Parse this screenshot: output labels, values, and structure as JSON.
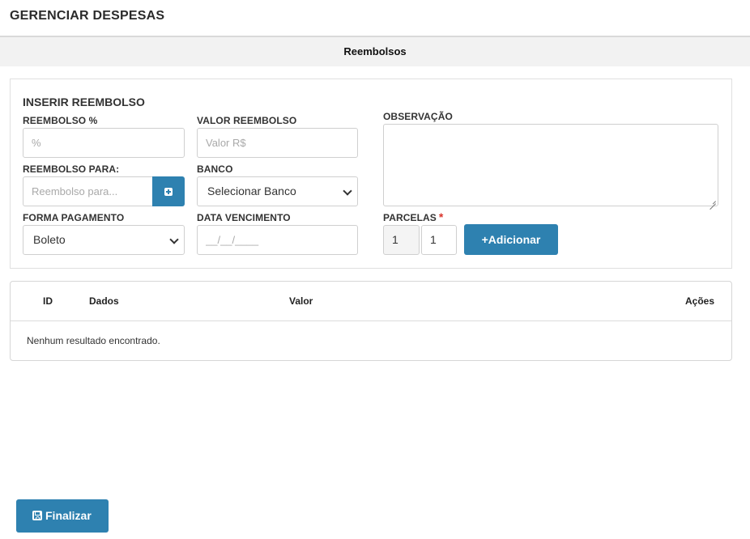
{
  "header": {
    "title": "GERENCIAR DESPESAS"
  },
  "tab": {
    "label": "Reembolsos"
  },
  "form": {
    "section_title": "INSERIR REEMBOLSO",
    "reembolso_percent": {
      "label": "REEMBOLSO %",
      "placeholder": "%",
      "value": ""
    },
    "valor_reembolso": {
      "label": "VALOR REEMBOLSO",
      "placeholder": "Valor R$",
      "value": ""
    },
    "observacao": {
      "label": "OBSERVAÇÃO",
      "value": ""
    },
    "reembolso_para": {
      "label": "REEMBOLSO PARA:",
      "placeholder": "Reembolso para...",
      "value": ""
    },
    "banco": {
      "label": "BANCO",
      "selected": "Selecionar Banco"
    },
    "forma_pagamento": {
      "label": "FORMA PAGAMENTO",
      "selected": "Boleto"
    },
    "data_vencimento": {
      "label": "DATA VENCIMENTO",
      "placeholder": "__/__/____",
      "value": ""
    },
    "parcelas": {
      "label": "PARCELAS",
      "required_mark": "*",
      "current": "1",
      "total": "1"
    },
    "add_button_label": "+Adicionar"
  },
  "table": {
    "columns": [
      "ID",
      "Dados",
      "Valor",
      "Ações"
    ],
    "empty_message": "Nenhum resultado encontrado."
  },
  "footer": {
    "finish_label": "Finalizar"
  },
  "colors": {
    "primary": "#2e81b0",
    "required": "#d9342b",
    "tab_bg": "#f2f2f2"
  },
  "icons": {
    "add_field": "plus-square-icon",
    "finish": "floppy-disk-icon",
    "select": "chevron-down-icon"
  }
}
